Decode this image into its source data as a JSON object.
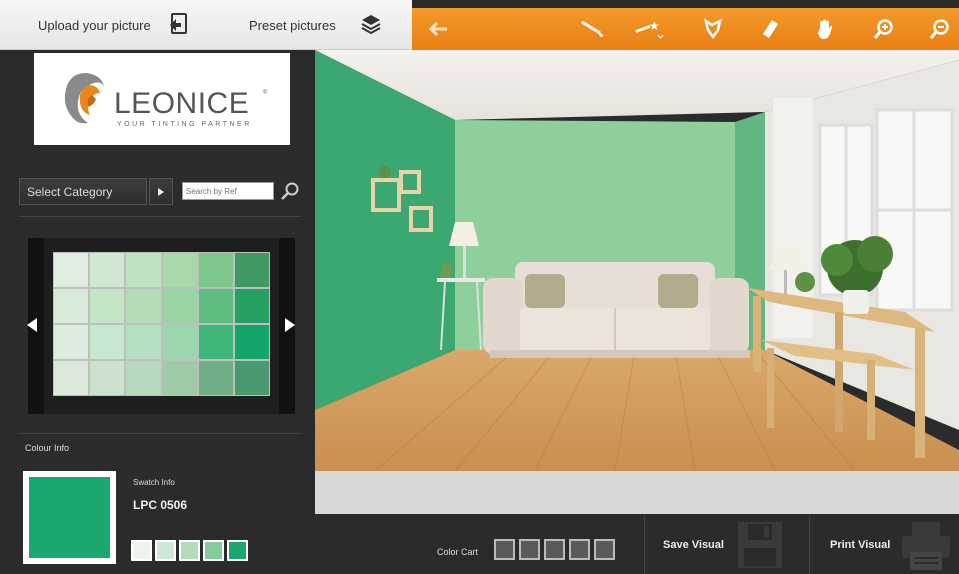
{
  "topbar": {
    "upload_label": "Upload your picture",
    "preset_label": "Preset pictures",
    "tools": [
      "back-arrow-icon",
      "brush-icon",
      "magic-wand-icon",
      "lasso-icon",
      "eraser-icon",
      "hand-icon",
      "zoom-in-icon",
      "zoom-out-icon"
    ]
  },
  "logo": {
    "brand": "LEONICE",
    "tagline": "YOUR TINTING PARTNER",
    "registered": "®"
  },
  "category": {
    "label": "Select Category",
    "search_placeholder": "Search by Ref"
  },
  "palette": {
    "rows": [
      [
        "#dfeee0",
        "#cfe8cf",
        "#bfe3c0",
        "#a9d9ab",
        "#7fc68a",
        "#3e9a62"
      ],
      [
        "#d7ebd8",
        "#c4e6c7",
        "#b2ddb7",
        "#98d5a3",
        "#5fbd80",
        "#27a064"
      ],
      [
        "#dcece0",
        "#c8e7cf",
        "#b4dfc0",
        "#9cd6ad",
        "#40b77a",
        "#13a56a"
      ],
      [
        "#dde8dc",
        "#cce2cd",
        "#b9d9bd",
        "#9fcaa7",
        "#6fae86",
        "#4a9a70"
      ]
    ]
  },
  "colour_info": {
    "heading": "Colour Info",
    "swatch_info_label": "Swatch Info",
    "code": "LPC 0506",
    "main_color": "#1aa86e",
    "tints": [
      "#eef3ee",
      "#cfe8d4",
      "#b2dcbc",
      "#86cc9b",
      "#1aa86e"
    ]
  },
  "bottombar": {
    "cart_label": "Color Cart",
    "cart_slots": 5,
    "save_label": "Save Visual",
    "print_label": "Print Visual"
  },
  "colors": {
    "accent": "#ee8a1f",
    "wall_left": "#3ba872",
    "wall_back": "#8fcf9c"
  }
}
